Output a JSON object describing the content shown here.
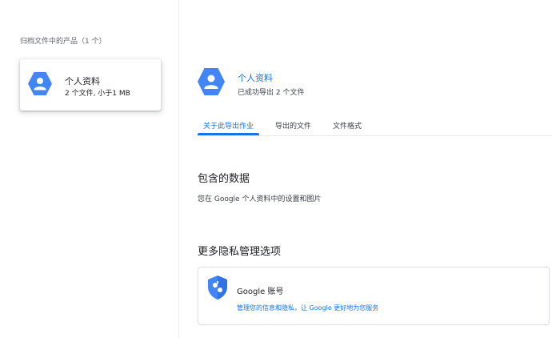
{
  "sidebar": {
    "heading": "归档文件中的产品（1 个）",
    "product": {
      "icon": "profile-hexagon-icon",
      "title": "个人资料",
      "subtitle": "2 个文件, 小于1 MB"
    }
  },
  "main": {
    "product": {
      "icon": "profile-hexagon-icon",
      "title": "个人资料",
      "status": "已成功导出 2 个文件"
    },
    "tabs": [
      {
        "label": "关于此导出作业",
        "active": true
      },
      {
        "label": "导出的文件",
        "active": false
      },
      {
        "label": "文件格式",
        "active": false
      }
    ],
    "included_data": {
      "heading": "包含的数据",
      "description": "您在 Google 个人资料中的设置和图片"
    },
    "privacy": {
      "heading": "更多隐私管理选项",
      "card": {
        "icon": "google-account-shield-icon",
        "title": "Google 账号",
        "link": "管理您的信息和隐私，让 Google 更好地为您服务"
      }
    }
  },
  "colors": {
    "accent": "#1a73e8",
    "icon_blue": "#4285f4",
    "text": "#202124",
    "muted": "#5f6368"
  }
}
